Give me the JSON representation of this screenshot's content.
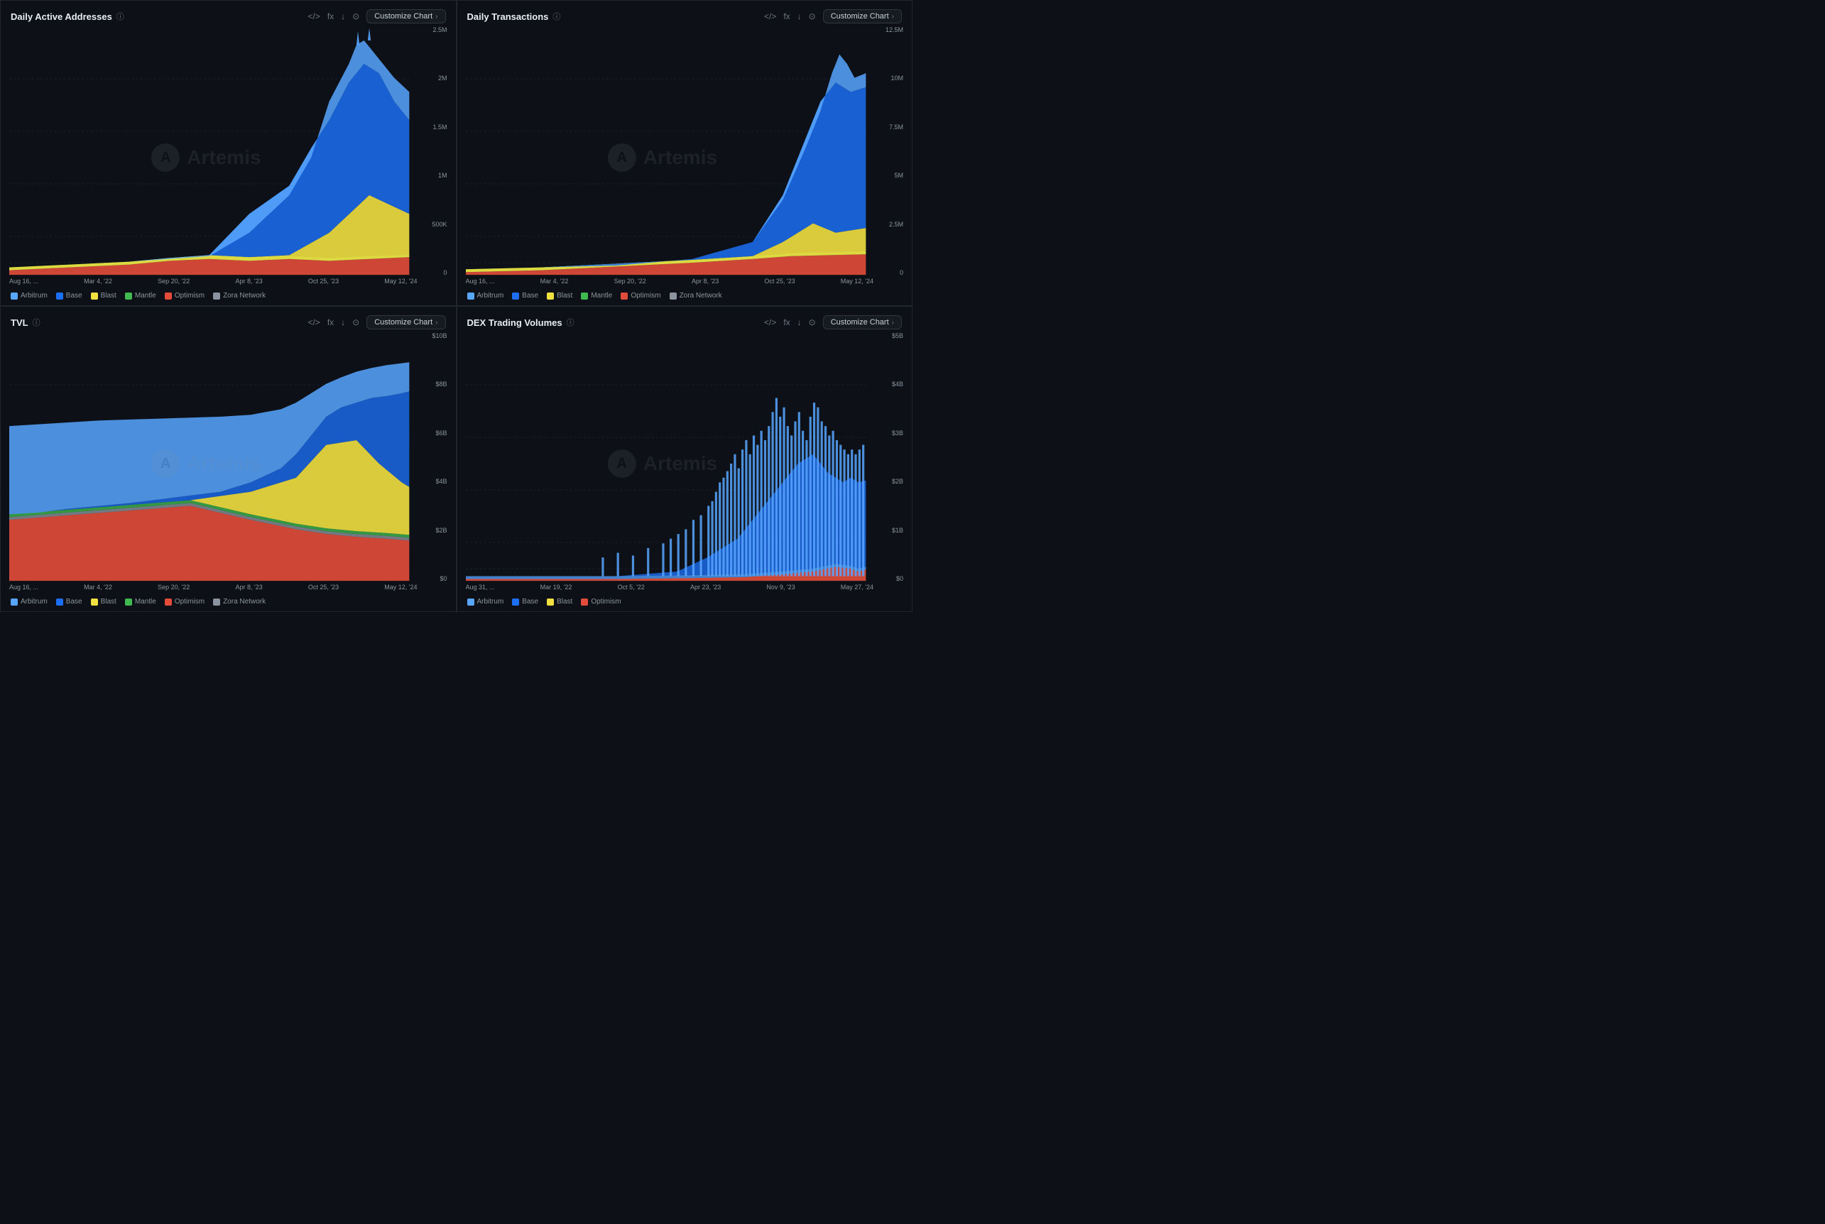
{
  "charts": [
    {
      "id": "daily-active-addresses",
      "title": "Daily Active Addresses",
      "customize_label": "Customize Chart",
      "yLabels": [
        "2.5M",
        "2M",
        "1.5M",
        "1M",
        "500K",
        "0"
      ],
      "xLabels": [
        "Aug 16, ...",
        "Mar 4, '22",
        "Sep 20, '22",
        "Apr 8, '23",
        "Oct 25, '23",
        "May 12, '24"
      ],
      "legend": [
        {
          "name": "Arbitrum",
          "color": "#58a6ff"
        },
        {
          "name": "Base",
          "color": "#1c6ef3"
        },
        {
          "name": "Blast",
          "color": "#f0e040"
        },
        {
          "name": "Mantle",
          "color": "#3fb950"
        },
        {
          "name": "Optimism",
          "color": "#e34c3a"
        },
        {
          "name": "Zora Network",
          "color": "#8b949e"
        }
      ]
    },
    {
      "id": "daily-transactions",
      "title": "Daily Transactions",
      "customize_label": "Customize Chart",
      "yLabels": [
        "12.5M",
        "10M",
        "7.5M",
        "5M",
        "2.5M",
        "0"
      ],
      "xLabels": [
        "Aug 16, ...",
        "Mar 4, '22",
        "Sep 20, '22",
        "Apr 8, '23",
        "Oct 25, '23",
        "May 12, '24"
      ],
      "legend": [
        {
          "name": "Arbitrum",
          "color": "#58a6ff"
        },
        {
          "name": "Base",
          "color": "#1c6ef3"
        },
        {
          "name": "Blast",
          "color": "#f0e040"
        },
        {
          "name": "Mantle",
          "color": "#3fb950"
        },
        {
          "name": "Optimism",
          "color": "#e34c3a"
        },
        {
          "name": "Zora Network",
          "color": "#8b949e"
        }
      ]
    },
    {
      "id": "tvl",
      "title": "TVL",
      "customize_label": "Customize Chart",
      "yLabels": [
        "$10B",
        "$8B",
        "$6B",
        "$4B",
        "$2B",
        "$0"
      ],
      "xLabels": [
        "Aug 16, ...",
        "Mar 4, '22",
        "Sep 20, '22",
        "Apr 8, '23",
        "Oct 25, '23",
        "May 12, '24"
      ],
      "legend": [
        {
          "name": "Arbitrum",
          "color": "#58a6ff"
        },
        {
          "name": "Base",
          "color": "#1c6ef3"
        },
        {
          "name": "Blast",
          "color": "#f0e040"
        },
        {
          "name": "Mantle",
          "color": "#3fb950"
        },
        {
          "name": "Optimism",
          "color": "#e34c3a"
        },
        {
          "name": "Zora Network",
          "color": "#8b949e"
        }
      ]
    },
    {
      "id": "dex-trading-volumes",
      "title": "DEX Trading Volumes",
      "customize_label": "Customize Chart",
      "yLabels": [
        "$5B",
        "$4B",
        "$3B",
        "$2B",
        "$1B",
        "$0"
      ],
      "xLabels": [
        "Aug 31, ...",
        "Mar 19, '22",
        "Oct 5, '22",
        "Apr 23, '23",
        "Nov 9, '23",
        "May 27, '24"
      ],
      "legend": [
        {
          "name": "Arbitrum",
          "color": "#58a6ff"
        },
        {
          "name": "Base",
          "color": "#1c6ef3"
        },
        {
          "name": "Blast",
          "color": "#f0e040"
        },
        {
          "name": "Optimism",
          "color": "#e34c3a"
        }
      ]
    }
  ],
  "icons": {
    "code": "</>",
    "fx": "fx",
    "download": "↓",
    "camera": "⊙",
    "info": "ⓘ",
    "chevron": "›"
  }
}
